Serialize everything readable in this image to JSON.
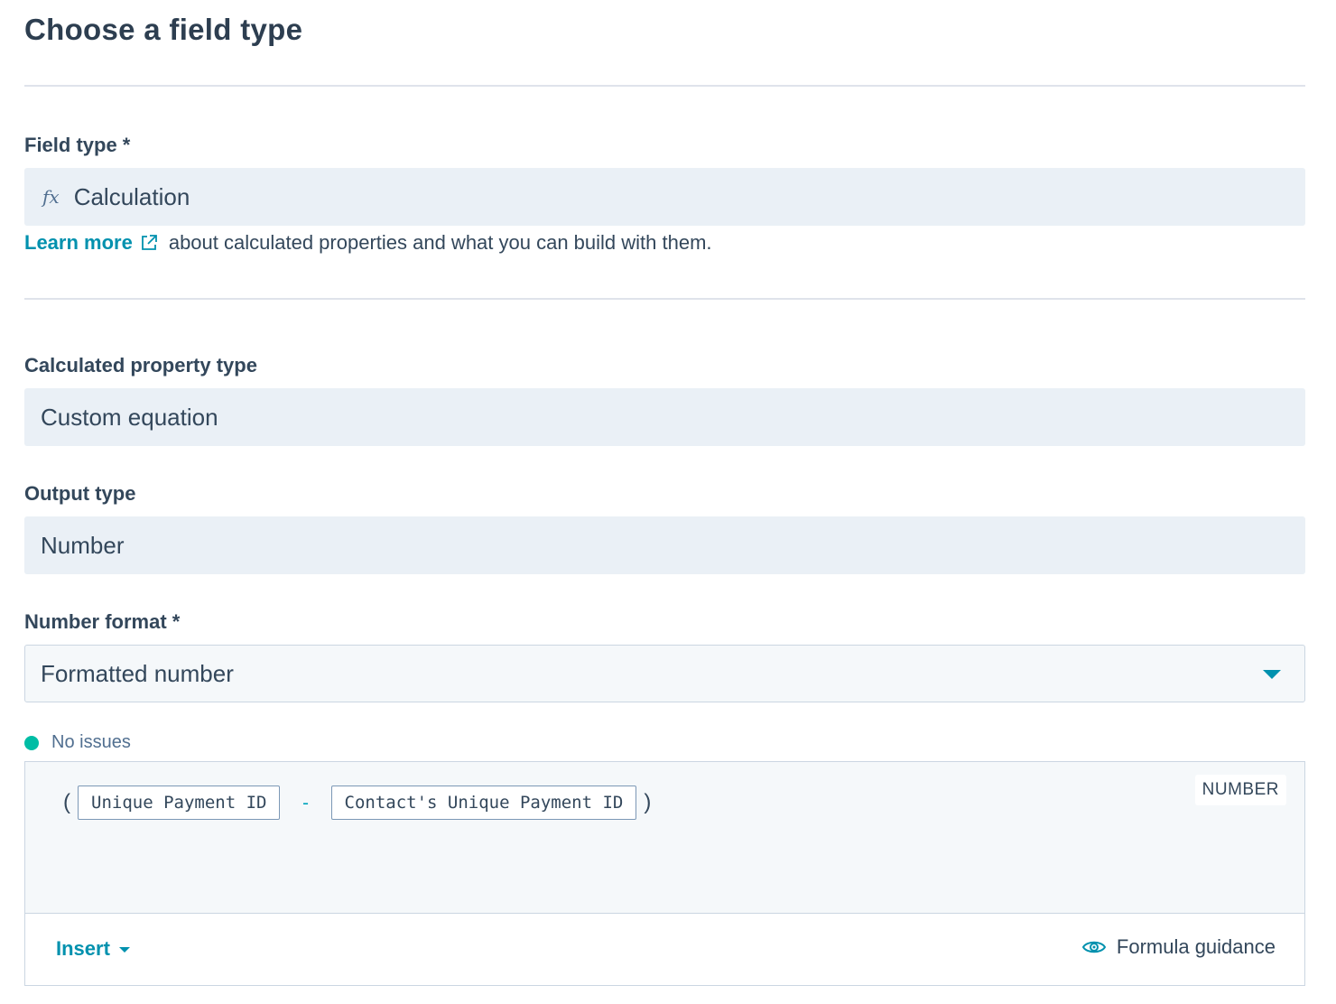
{
  "header": {
    "title": "Choose a field type"
  },
  "field_type": {
    "label": "Field type *",
    "icon": "fx",
    "value": "Calculation"
  },
  "help": {
    "link_text": "Learn more",
    "text": "about calculated properties and what you can build with them."
  },
  "calculated_property_type": {
    "label": "Calculated property type",
    "value": "Custom equation"
  },
  "output_type": {
    "label": "Output type",
    "value": "Number"
  },
  "number_format": {
    "label": "Number format *",
    "value": "Formatted number"
  },
  "status": {
    "text": "No issues",
    "color": "#00bda5"
  },
  "formula": {
    "open_paren": "(",
    "token_1": "Unique Payment ID",
    "operator": "-",
    "token_2": "Contact's Unique Payment ID",
    "close_paren": ")",
    "type_badge": "NUMBER"
  },
  "footer": {
    "insert_label": "Insert",
    "guidance_label": "Formula guidance"
  },
  "colors": {
    "accent": "#0091ae",
    "field_bg": "#eaf0f6",
    "text": "#33475b"
  }
}
